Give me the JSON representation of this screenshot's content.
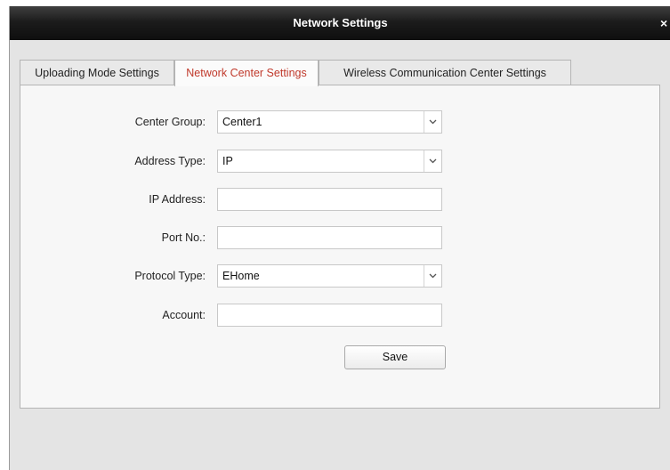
{
  "window": {
    "title": "Network Settings",
    "close_glyph": "×"
  },
  "tabs": [
    {
      "label": "Uploading Mode Settings",
      "active": false
    },
    {
      "label": "Network Center Settings",
      "active": true
    },
    {
      "label": "Wireless Communication Center Settings",
      "active": false
    }
  ],
  "form": {
    "center_group": {
      "label": "Center Group:",
      "value": "Center1"
    },
    "address_type": {
      "label": "Address Type:",
      "value": "IP"
    },
    "ip_address": {
      "label": "IP Address:",
      "value": ""
    },
    "port_no": {
      "label": "Port No.:",
      "value": ""
    },
    "protocol_type": {
      "label": "Protocol Type:",
      "value": "EHome"
    },
    "account": {
      "label": "Account:",
      "value": ""
    }
  },
  "buttons": {
    "save": "Save"
  },
  "icons": {
    "close": "close-icon",
    "dropdown": "chevron-down-icon"
  },
  "colors": {
    "active_tab_text": "#c0392b",
    "titlebar": "#1c1c1c"
  }
}
